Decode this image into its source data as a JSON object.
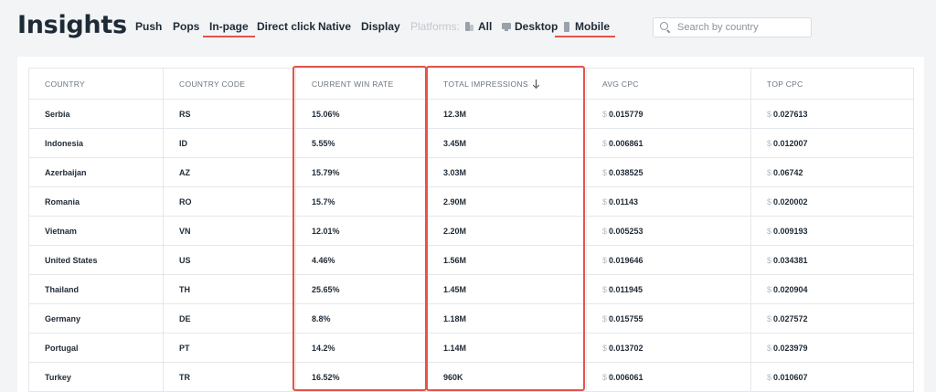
{
  "header": {
    "title": "Insights",
    "tabs": [
      {
        "label": "Push",
        "active": false
      },
      {
        "label": "Pops",
        "active": false
      },
      {
        "label": "In-page",
        "active": true
      },
      {
        "label": "Direct click",
        "active": false
      },
      {
        "label": "Native",
        "active": false
      },
      {
        "label": "Display",
        "active": false
      }
    ],
    "platforms_label": "Platforms:",
    "platforms": [
      {
        "label": "All",
        "icon": "all-devices-icon",
        "active": false
      },
      {
        "label": "Desktop",
        "icon": "desktop-icon",
        "active": false
      },
      {
        "label": "Mobile",
        "icon": "mobile-icon",
        "active": true
      }
    ],
    "search": {
      "placeholder": "Search by country",
      "value": ""
    }
  },
  "colors": {
    "accent": "#e2554a",
    "text": "#1e2a36",
    "muted": "#6b7480"
  },
  "table": {
    "columns": [
      "COUNTRY",
      "COUNTRY CODE",
      "CURRENT WIN RATE",
      "TOTAL IMPRESSIONS",
      "AVG CPC",
      "TOP CPC"
    ],
    "sorted_column": "TOTAL IMPRESSIONS",
    "sort_direction": "descending",
    "currency_symbol": "$",
    "highlighted_columns": [
      "CURRENT WIN RATE",
      "TOTAL IMPRESSIONS"
    ],
    "rows": [
      {
        "country": "Serbia",
        "code": "RS",
        "win_rate": "15.06%",
        "impressions": "12.3M",
        "avg_cpc": "0.015779",
        "top_cpc": "0.027613"
      },
      {
        "country": "Indonesia",
        "code": "ID",
        "win_rate": "5.55%",
        "impressions": "3.45M",
        "avg_cpc": "0.006861",
        "top_cpc": "0.012007"
      },
      {
        "country": "Azerbaijan",
        "code": "AZ",
        "win_rate": "15.79%",
        "impressions": "3.03M",
        "avg_cpc": "0.038525",
        "top_cpc": "0.06742"
      },
      {
        "country": "Romania",
        "code": "RO",
        "win_rate": "15.7%",
        "impressions": "2.90M",
        "avg_cpc": "0.01143",
        "top_cpc": "0.020002"
      },
      {
        "country": "Vietnam",
        "code": "VN",
        "win_rate": "12.01%",
        "impressions": "2.20M",
        "avg_cpc": "0.005253",
        "top_cpc": "0.009193"
      },
      {
        "country": "United States",
        "code": "US",
        "win_rate": "4.46%",
        "impressions": "1.56M",
        "avg_cpc": "0.019646",
        "top_cpc": "0.034381"
      },
      {
        "country": "Thailand",
        "code": "TH",
        "win_rate": "25.65%",
        "impressions": "1.45M",
        "avg_cpc": "0.011945",
        "top_cpc": "0.020904"
      },
      {
        "country": "Germany",
        "code": "DE",
        "win_rate": "8.8%",
        "impressions": "1.18M",
        "avg_cpc": "0.015755",
        "top_cpc": "0.027572"
      },
      {
        "country": "Portugal",
        "code": "PT",
        "win_rate": "14.2%",
        "impressions": "1.14M",
        "avg_cpc": "0.013702",
        "top_cpc": "0.023979"
      },
      {
        "country": "Turkey",
        "code": "TR",
        "win_rate": "16.52%",
        "impressions": "960K",
        "avg_cpc": "0.006061",
        "top_cpc": "0.010607"
      }
    ]
  }
}
